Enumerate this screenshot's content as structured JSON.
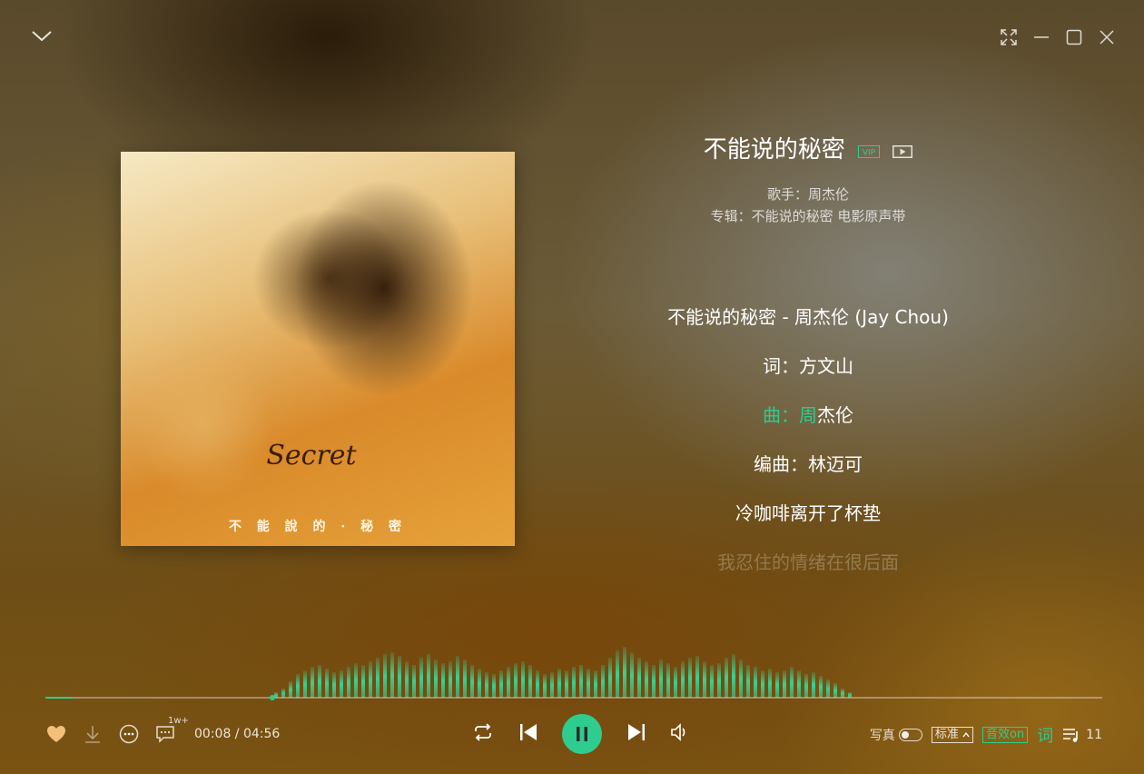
{
  "window": {
    "collapse_icon": "chevron-down-icon",
    "controls": [
      "fullscreen-icon",
      "minimize-icon",
      "maximize-icon",
      "close-icon"
    ]
  },
  "album": {
    "cover_logo": "Secret",
    "cover_title": "不 能 說 的 · 秘 密"
  },
  "song": {
    "title": "不能说的秘密",
    "vip_badge": "VIP",
    "singer_label": "歌手：周杰伦",
    "album_label": "专辑：不能说的秘密 电影原声带"
  },
  "lyrics": {
    "line1": "不能说的秘密 - 周杰伦 (Jay Chou)",
    "line2": "词：方文山",
    "line3_sung": "曲：周",
    "line3_rest": "杰伦",
    "line4": "编曲：林迈可",
    "line5": "冷咖啡离开了杯垫",
    "line6": "我忍住的情绪在很后面"
  },
  "player": {
    "current_time": "00:08",
    "total_time": "04:56",
    "time_display": "00:08 / 04:56",
    "progress": 0.027,
    "comment_count": "1w+",
    "accent_color": "#2ecc8f"
  },
  "controls": {
    "portrait_label": "写真",
    "quality_label": "标准",
    "effect_label": "音效on",
    "lyric_label": "词",
    "queue_count": "11"
  },
  "visualizer": {
    "bars": [
      6,
      10,
      18,
      26,
      30,
      34,
      36,
      32,
      28,
      30,
      34,
      38,
      36,
      40,
      44,
      48,
      50,
      46,
      40,
      36,
      44,
      48,
      42,
      38,
      40,
      46,
      42,
      36,
      32,
      28,
      26,
      30,
      34,
      38,
      40,
      36,
      30,
      26,
      28,
      32,
      30,
      34,
      36,
      32,
      30,
      36,
      44,
      52,
      56,
      50,
      44,
      40,
      36,
      42,
      38,
      34,
      40,
      44,
      46,
      40,
      36,
      38,
      44,
      48,
      42,
      36,
      34,
      30,
      32,
      28,
      30,
      34,
      30,
      26,
      28,
      24,
      20,
      16,
      10,
      6
    ]
  }
}
